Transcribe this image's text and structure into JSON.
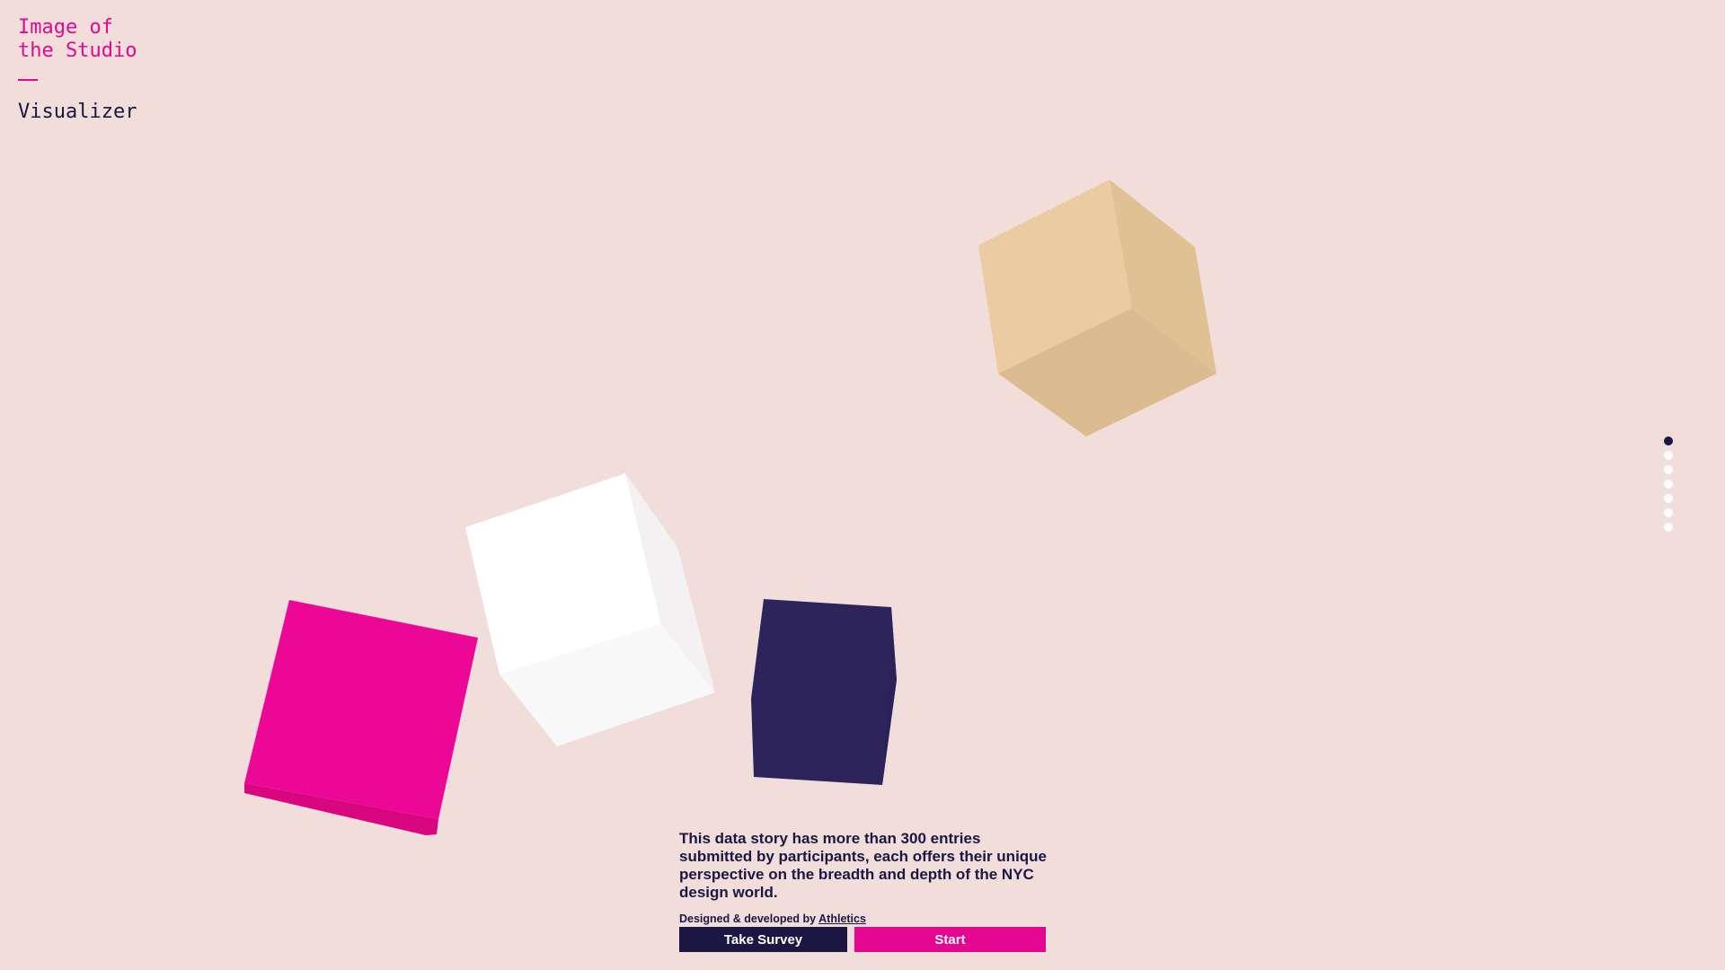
{
  "brand": {
    "title": "Image of\nthe Studio",
    "subtitle": "Visualizer"
  },
  "cubes": [
    {
      "name": "tan-cube",
      "colors": [
        "#ebcba1",
        "#e0c194",
        "#dbbb8f"
      ]
    },
    {
      "name": "white-cube",
      "colors": [
        "#ffffff",
        "#f3f1f1",
        "#f8f8f8"
      ]
    },
    {
      "name": "pink-cube",
      "colors": [
        "#ec0797",
        "#d8067f"
      ]
    },
    {
      "name": "navy-cube",
      "colors": [
        "#2e245c",
        "#2b2258"
      ]
    }
  ],
  "pagination": {
    "count": 7,
    "active_index": 0
  },
  "intro": {
    "text": "This data story has more than 300 entries submitted by participants, each offers their unique perspective on the breadth and depth of the NYC design world.",
    "credit_prefix": "Designed & developed by ",
    "credit_link": "Athletics"
  },
  "actions": {
    "survey_label": "Take Survey",
    "start_label": "Start"
  },
  "colors": {
    "background": "#f1dedb",
    "accent": "#e5078f",
    "navy": "#1b1642"
  }
}
